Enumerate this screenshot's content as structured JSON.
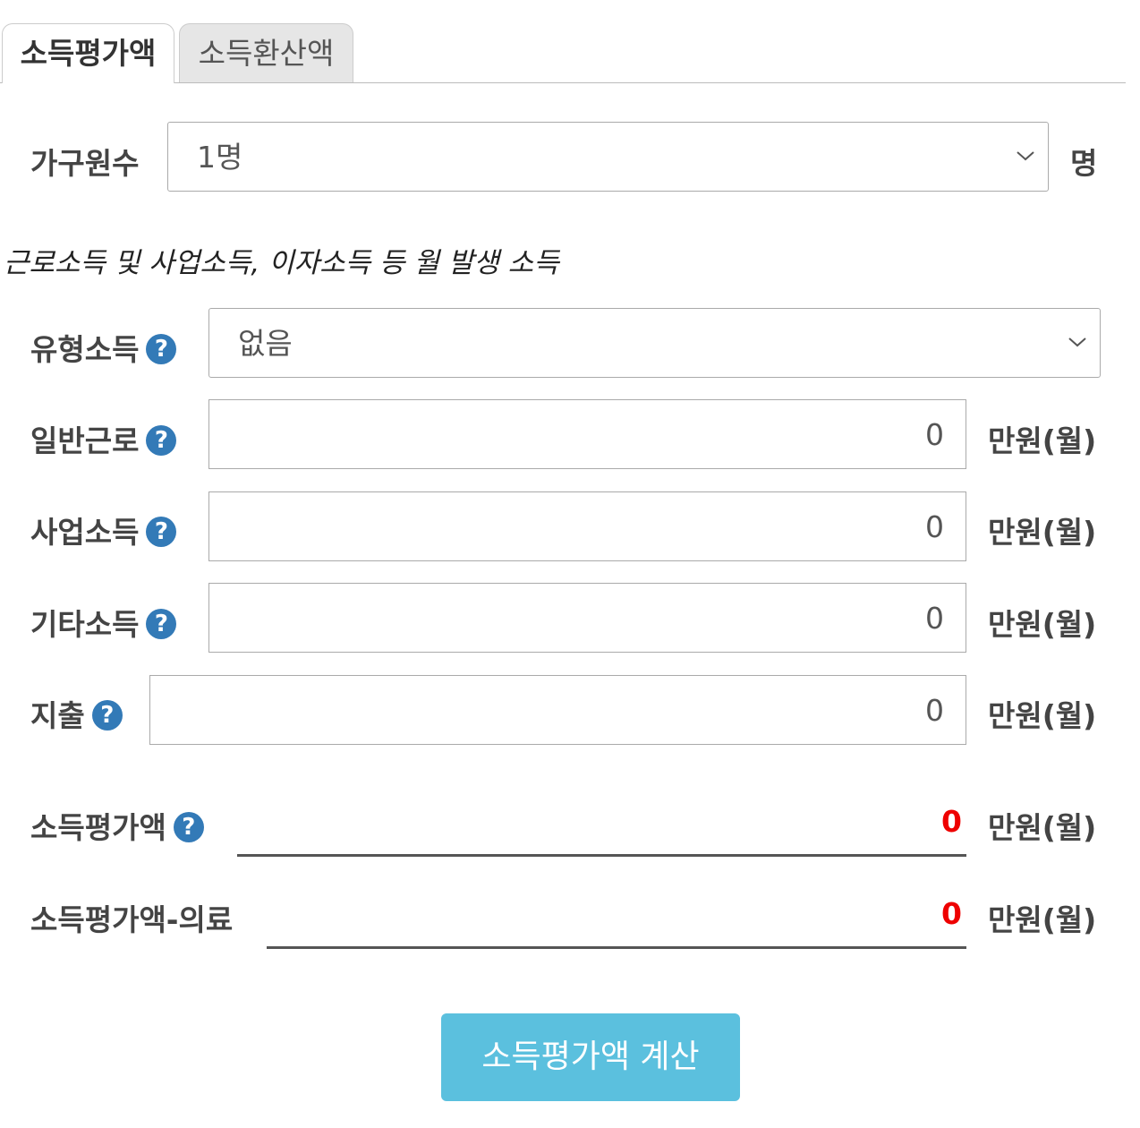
{
  "tabs": [
    {
      "label": "소득평가액",
      "active": true
    },
    {
      "label": "소득환산액",
      "active": false
    }
  ],
  "household": {
    "label": "가구원수",
    "value": "1명",
    "unit": "명"
  },
  "note": "근로소득 및 사업소득, 이자소득 등 월 발생 소득",
  "type_income": {
    "label": "유형소득",
    "value": "없음"
  },
  "incomes": [
    {
      "label": "일반근로",
      "value": "0",
      "unit": "만원(월)"
    },
    {
      "label": "사업소득",
      "value": "0",
      "unit": "만원(월)"
    },
    {
      "label": "기타소득",
      "value": "0",
      "unit": "만원(월)"
    },
    {
      "label": "지출",
      "value": "0",
      "unit": "만원(월)"
    }
  ],
  "results": [
    {
      "label": "소득평가액",
      "value": "0",
      "unit": "만원(월)"
    },
    {
      "label": "소득평가액-의료",
      "value": "0",
      "unit": "만원(월)"
    }
  ],
  "help_symbol": "?",
  "button": {
    "label": "소득평가액 계산"
  },
  "colors": {
    "accent": "#5bc0de",
    "help": "#337ab7",
    "result": "#ee0000"
  },
  "icons": {
    "help": "question-circle-icon",
    "dropdown": "chevron-down-icon"
  }
}
